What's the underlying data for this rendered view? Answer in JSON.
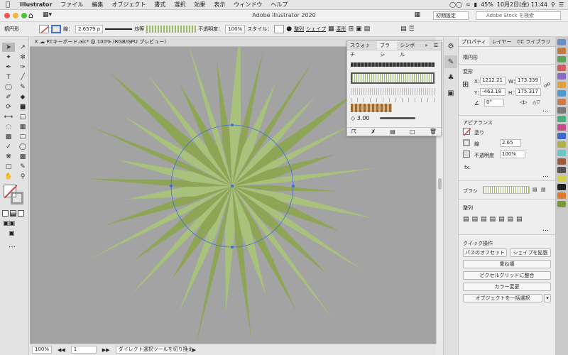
{
  "menubar": {
    "apple": "",
    "app_name": "Illustrator",
    "items": [
      "ファイル",
      "編集",
      "オブジェクト",
      "書式",
      "選択",
      "効果",
      "表示",
      "ウィンドウ",
      "ヘルプ"
    ],
    "battery": "45%",
    "datetime": "10月2日(金)  11:44"
  },
  "appbar": {
    "title": "Adobe Illustrator 2020",
    "workspace": "初期設定",
    "stock_placeholder": "Adobe Stock を検索"
  },
  "controlbar": {
    "object_type": "楕円形",
    "stroke_label": "線：",
    "stroke_value": "2.6579 p",
    "profile": "均等",
    "opacity_label": "不透明度：",
    "opacity_value": "100%",
    "style_label": "スタイル：",
    "align_label": "整列",
    "shape_label": "シェイプ",
    "transform_label": "変形"
  },
  "document": {
    "tab_title": "PCキーボード.aic* @ 100% (RGB/GPU プレビュー)"
  },
  "statusbar": {
    "zoom": "100%",
    "artboard": "1",
    "tool_hint": "ダイレクト選択ツールを切り換え"
  },
  "brush_panel": {
    "tabs": [
      "スウォッチ",
      "ブラシ",
      "シンボル"
    ],
    "active_tab": "ブラシ",
    "size_value": "3.00"
  },
  "properties": {
    "tabs": [
      "プロパティ",
      "レイヤー",
      "CC ライブラリ"
    ],
    "object_type": "楕円形",
    "transform": {
      "heading": "変形",
      "x_label": "X：",
      "x_value": "1212.21",
      "y_label": "Y：",
      "y_value": "-463.18",
      "w_label": "W：",
      "w_value": "173.339",
      "h_label": "H：",
      "h_value": "175.317",
      "angle_value": "0°"
    },
    "appearance": {
      "heading": "アピアランス",
      "fill_label": "塗り",
      "stroke_label": "線",
      "stroke_value": "2.65",
      "opacity_label": "不透明度",
      "opacity_value": "100%",
      "fx_label": "fx."
    },
    "brush_label": "ブラシ",
    "align_heading": "整列",
    "quick_actions": {
      "heading": "クイック操作",
      "offset_path": "パスのオフセット",
      "expand_shape": "シェイプを拡張",
      "arrange": "重ね順",
      "pixel_grid": "ピクセルグリッドに整合",
      "recolor": "カラー変更",
      "select_same": "オブジェクトを一括選択"
    }
  },
  "colors": {
    "canvas": "#a3a3a3",
    "burst_dark": "#8da552",
    "burst_light": "#a9c47a",
    "selection": "#3f6fd6",
    "no_fill_red": "#d93a3a"
  }
}
